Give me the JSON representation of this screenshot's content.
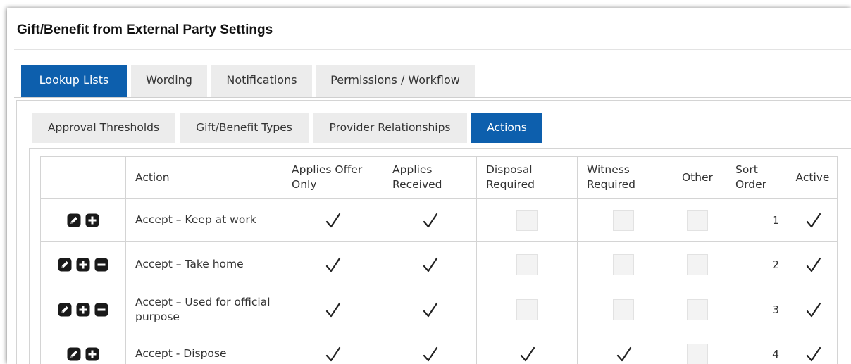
{
  "page": {
    "title": "Gift/Benefit from External Party Settings"
  },
  "tabs": [
    {
      "label": "Lookup Lists",
      "active": true
    },
    {
      "label": "Wording",
      "active": false
    },
    {
      "label": "Notifications",
      "active": false
    },
    {
      "label": "Permissions / Workflow",
      "active": false
    }
  ],
  "subtabs": [
    {
      "label": "Approval Thresholds",
      "active": false
    },
    {
      "label": "Gift/Benefit Types",
      "active": false
    },
    {
      "label": "Provider Relationships",
      "active": false
    },
    {
      "label": "Actions",
      "active": true
    }
  ],
  "table": {
    "headers": {
      "action": "Action",
      "offer_only": "Applies Offer Only",
      "received": "Applies Received",
      "disposal": "Disposal Required",
      "witness": "Witness Required",
      "other": "Other",
      "sort_order": "Sort Order",
      "active": "Active"
    },
    "rows": [
      {
        "action": "Accept – Keep at work",
        "icons": [
          "edit-icon",
          "add-icon"
        ],
        "offer_only": true,
        "received": true,
        "disposal": false,
        "witness": false,
        "other": false,
        "sort_order": "1",
        "active": true
      },
      {
        "action": "Accept – Take home",
        "icons": [
          "edit-icon",
          "add-icon",
          "remove-icon"
        ],
        "offer_only": true,
        "received": true,
        "disposal": false,
        "witness": false,
        "other": false,
        "sort_order": "2",
        "active": true
      },
      {
        "action": "Accept – Used for official purpose",
        "icons": [
          "edit-icon",
          "add-icon",
          "remove-icon"
        ],
        "offer_only": true,
        "received": true,
        "disposal": false,
        "witness": false,
        "other": false,
        "sort_order": "3",
        "active": true
      },
      {
        "action": "Accept - Dispose",
        "icons": [
          "edit-icon",
          "add-icon"
        ],
        "offer_only": true,
        "received": true,
        "disposal": true,
        "witness": true,
        "other": false,
        "sort_order": "4",
        "active": true
      }
    ]
  },
  "colors": {
    "accent": "#0d5fad",
    "tab_bg": "#ececec",
    "border": "#d4d4d4",
    "unchecked_bg": "#f3f3f3"
  }
}
